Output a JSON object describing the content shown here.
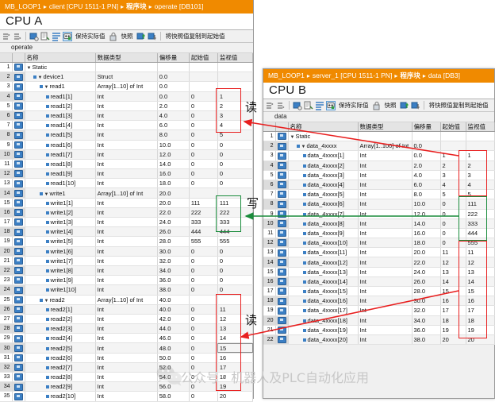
{
  "colors": {
    "breadcrumb_bg": "#f08a00",
    "monitor_cell_bg": "#fbc56b",
    "read_box": "#e81f1f",
    "write_box": "#1a8c3c"
  },
  "cpu_a": {
    "breadcrumb": {
      "project": "MB_LOOP1",
      "device": "client [CPU 1511-1 PN]",
      "folder": "程序块",
      "block": "operate [DB101]",
      "separator": "▸"
    },
    "title": "CPU A",
    "toolbar": {
      "keep_actual_label": "保持实际值",
      "snapshot_label": "快照",
      "copy_snapshot_label": "将快照值复制到起始值"
    },
    "block_name": "operate",
    "columns": [
      "名称",
      "数据类型",
      "偏移量",
      "起始值",
      "监视值"
    ],
    "rows": [
      {
        "n": "1",
        "name": "Static",
        "type": "",
        "offset": "",
        "start": "",
        "monitor": "",
        "indent": 0,
        "expander": "▼",
        "bullet": false
      },
      {
        "n": "2",
        "name": "device1",
        "type": "Struct",
        "offset": "0.0",
        "start": "",
        "monitor": "",
        "indent": 1,
        "expander": "▼",
        "bullet": true
      },
      {
        "n": "3",
        "name": "read1",
        "type": "Array[1..10] of Int",
        "offset": "0.0",
        "start": "",
        "monitor": "",
        "indent": 2,
        "expander": "▼",
        "bullet": true
      },
      {
        "n": "4",
        "name": "read1[1]",
        "type": "Int",
        "offset": "0.0",
        "start": "0",
        "monitor": "1",
        "indent": 3,
        "expander": "",
        "bullet": true
      },
      {
        "n": "5",
        "name": "read1[2]",
        "type": "Int",
        "offset": "2.0",
        "start": "0",
        "monitor": "2",
        "indent": 3,
        "expander": "",
        "bullet": true
      },
      {
        "n": "6",
        "name": "read1[3]",
        "type": "Int",
        "offset": "4.0",
        "start": "0",
        "monitor": "3",
        "indent": 3,
        "expander": "",
        "bullet": true
      },
      {
        "n": "7",
        "name": "read1[4]",
        "type": "Int",
        "offset": "6.0",
        "start": "0",
        "monitor": "4",
        "indent": 3,
        "expander": "",
        "bullet": true
      },
      {
        "n": "8",
        "name": "read1[5]",
        "type": "Int",
        "offset": "8.0",
        "start": "0",
        "monitor": "5",
        "indent": 3,
        "expander": "",
        "bullet": true
      },
      {
        "n": "9",
        "name": "read1[6]",
        "type": "Int",
        "offset": "10.0",
        "start": "0",
        "monitor": "0",
        "indent": 3,
        "expander": "",
        "bullet": true
      },
      {
        "n": "10",
        "name": "read1[7]",
        "type": "Int",
        "offset": "12.0",
        "start": "0",
        "monitor": "0",
        "indent": 3,
        "expander": "",
        "bullet": true
      },
      {
        "n": "11",
        "name": "read1[8]",
        "type": "Int",
        "offset": "14.0",
        "start": "0",
        "monitor": "0",
        "indent": 3,
        "expander": "",
        "bullet": true
      },
      {
        "n": "12",
        "name": "read1[9]",
        "type": "Int",
        "offset": "16.0",
        "start": "0",
        "monitor": "0",
        "indent": 3,
        "expander": "",
        "bullet": true
      },
      {
        "n": "13",
        "name": "read1[10]",
        "type": "Int",
        "offset": "18.0",
        "start": "0",
        "monitor": "0",
        "indent": 3,
        "expander": "",
        "bullet": true
      },
      {
        "n": "14",
        "name": "write1",
        "type": "Array[1..10] of Int",
        "offset": "20.0",
        "start": "",
        "monitor": "",
        "indent": 2,
        "expander": "▼",
        "bullet": true
      },
      {
        "n": "15",
        "name": "write1[1]",
        "type": "Int",
        "offset": "20.0",
        "start": "111",
        "monitor": "111",
        "indent": 3,
        "expander": "",
        "bullet": true
      },
      {
        "n": "16",
        "name": "write1[2]",
        "type": "Int",
        "offset": "22.0",
        "start": "222",
        "monitor": "222",
        "indent": 3,
        "expander": "",
        "bullet": true
      },
      {
        "n": "17",
        "name": "write1[3]",
        "type": "Int",
        "offset": "24.0",
        "start": "333",
        "monitor": "333",
        "indent": 3,
        "expander": "",
        "bullet": true
      },
      {
        "n": "18",
        "name": "write1[4]",
        "type": "Int",
        "offset": "26.0",
        "start": "444",
        "monitor": "444",
        "indent": 3,
        "expander": "",
        "bullet": true
      },
      {
        "n": "19",
        "name": "write1[5]",
        "type": "Int",
        "offset": "28.0",
        "start": "555",
        "monitor": "555",
        "indent": 3,
        "expander": "",
        "bullet": true
      },
      {
        "n": "20",
        "name": "write1[6]",
        "type": "Int",
        "offset": "30.0",
        "start": "0",
        "monitor": "0",
        "indent": 3,
        "expander": "",
        "bullet": true
      },
      {
        "n": "21",
        "name": "write1[7]",
        "type": "Int",
        "offset": "32.0",
        "start": "0",
        "monitor": "0",
        "indent": 3,
        "expander": "",
        "bullet": true
      },
      {
        "n": "22",
        "name": "write1[8]",
        "type": "Int",
        "offset": "34.0",
        "start": "0",
        "monitor": "0",
        "indent": 3,
        "expander": "",
        "bullet": true
      },
      {
        "n": "23",
        "name": "write1[9]",
        "type": "Int",
        "offset": "36.0",
        "start": "0",
        "monitor": "0",
        "indent": 3,
        "expander": "",
        "bullet": true
      },
      {
        "n": "24",
        "name": "write1[10]",
        "type": "Int",
        "offset": "38.0",
        "start": "0",
        "monitor": "0",
        "indent": 3,
        "expander": "",
        "bullet": true
      },
      {
        "n": "25",
        "name": "read2",
        "type": "Array[1..10] of Int",
        "offset": "40.0",
        "start": "",
        "monitor": "",
        "indent": 2,
        "expander": "▼",
        "bullet": true
      },
      {
        "n": "26",
        "name": "read2[1]",
        "type": "Int",
        "offset": "40.0",
        "start": "0",
        "monitor": "11",
        "indent": 3,
        "expander": "",
        "bullet": true
      },
      {
        "n": "27",
        "name": "read2[2]",
        "type": "Int",
        "offset": "42.0",
        "start": "0",
        "monitor": "12",
        "indent": 3,
        "expander": "",
        "bullet": true
      },
      {
        "n": "28",
        "name": "read2[3]",
        "type": "Int",
        "offset": "44.0",
        "start": "0",
        "monitor": "13",
        "indent": 3,
        "expander": "",
        "bullet": true
      },
      {
        "n": "29",
        "name": "read2[4]",
        "type": "Int",
        "offset": "46.0",
        "start": "0",
        "monitor": "14",
        "indent": 3,
        "expander": "",
        "bullet": true
      },
      {
        "n": "30",
        "name": "read2[5]",
        "type": "Int",
        "offset": "48.0",
        "start": "0",
        "monitor": "15",
        "indent": 3,
        "expander": "",
        "bullet": true,
        "selected": true
      },
      {
        "n": "31",
        "name": "read2[6]",
        "type": "Int",
        "offset": "50.0",
        "start": "0",
        "monitor": "16",
        "indent": 3,
        "expander": "",
        "bullet": true
      },
      {
        "n": "32",
        "name": "read2[7]",
        "type": "Int",
        "offset": "52.0",
        "start": "0",
        "monitor": "17",
        "indent": 3,
        "expander": "",
        "bullet": true
      },
      {
        "n": "33",
        "name": "read2[8]",
        "type": "Int",
        "offset": "54.0",
        "start": "0",
        "monitor": "18",
        "indent": 3,
        "expander": "",
        "bullet": true
      },
      {
        "n": "34",
        "name": "read2[9]",
        "type": "Int",
        "offset": "56.0",
        "start": "0",
        "monitor": "19",
        "indent": 3,
        "expander": "",
        "bullet": true
      },
      {
        "n": "35",
        "name": "read2[10]",
        "type": "Int",
        "offset": "58.0",
        "start": "0",
        "monitor": "20",
        "indent": 3,
        "expander": "",
        "bullet": true
      }
    ]
  },
  "cpu_b": {
    "breadcrumb": {
      "project": "MB_LOOP1",
      "device": "server_1 [CPU 1511-1 PN]",
      "folder": "程序块",
      "block": "data [DB3]",
      "separator": "▸"
    },
    "title": "CPU B",
    "toolbar": {
      "keep_actual_label": "保持实际值",
      "snapshot_label": "快照",
      "copy_snapshot_label": "将快照值复制到起始值"
    },
    "block_name": "data",
    "columns": [
      "名称",
      "数据类型",
      "偏移量",
      "起始值",
      "监视值"
    ],
    "rows": [
      {
        "n": "1",
        "name": "Static",
        "type": "",
        "offset": "",
        "start": "",
        "monitor": "",
        "indent": 0,
        "expander": "▼",
        "bullet": false
      },
      {
        "n": "2",
        "name": "data_4xxxx",
        "type": "Array[1..100] of Int",
        "offset": "0.0",
        "start": "",
        "monitor": "",
        "indent": 1,
        "expander": "▼",
        "bullet": true
      },
      {
        "n": "3",
        "name": "data_4xxxx[1]",
        "type": "Int",
        "offset": "0.0",
        "start": "1",
        "monitor": "1",
        "indent": 2,
        "expander": "",
        "bullet": true
      },
      {
        "n": "4",
        "name": "data_4xxxx[2]",
        "type": "Int",
        "offset": "2.0",
        "start": "2",
        "monitor": "2",
        "indent": 2,
        "expander": "",
        "bullet": true
      },
      {
        "n": "5",
        "name": "data_4xxxx[3]",
        "type": "Int",
        "offset": "4.0",
        "start": "3",
        "monitor": "3",
        "indent": 2,
        "expander": "",
        "bullet": true
      },
      {
        "n": "6",
        "name": "data_4xxxx[4]",
        "type": "Int",
        "offset": "6.0",
        "start": "4",
        "monitor": "4",
        "indent": 2,
        "expander": "",
        "bullet": true
      },
      {
        "n": "7",
        "name": "data_4xxxx[5]",
        "type": "Int",
        "offset": "8.0",
        "start": "5",
        "monitor": "5",
        "indent": 2,
        "expander": "",
        "bullet": true
      },
      {
        "n": "8",
        "name": "data_4xxxx[6]",
        "type": "Int",
        "offset": "10.0",
        "start": "0",
        "monitor": "111",
        "indent": 2,
        "expander": "",
        "bullet": true
      },
      {
        "n": "9",
        "name": "data_4xxxx[7]",
        "type": "Int",
        "offset": "12.0",
        "start": "0",
        "monitor": "222",
        "indent": 2,
        "expander": "",
        "bullet": true
      },
      {
        "n": "10",
        "name": "data_4xxxx[8]",
        "type": "Int",
        "offset": "14.0",
        "start": "0",
        "monitor": "333",
        "indent": 2,
        "expander": "",
        "bullet": true
      },
      {
        "n": "11",
        "name": "data_4xxxx[9]",
        "type": "Int",
        "offset": "16.0",
        "start": "0",
        "monitor": "444",
        "indent": 2,
        "expander": "",
        "bullet": true
      },
      {
        "n": "12",
        "name": "data_4xxxx[10]",
        "type": "Int",
        "offset": "18.0",
        "start": "0",
        "monitor": "555",
        "indent": 2,
        "expander": "",
        "bullet": true
      },
      {
        "n": "13",
        "name": "data_4xxxx[11]",
        "type": "Int",
        "offset": "20.0",
        "start": "11",
        "monitor": "11",
        "indent": 2,
        "expander": "",
        "bullet": true
      },
      {
        "n": "14",
        "name": "data_4xxxx[12]",
        "type": "Int",
        "offset": "22.0",
        "start": "12",
        "monitor": "12",
        "indent": 2,
        "expander": "",
        "bullet": true
      },
      {
        "n": "15",
        "name": "data_4xxxx[13]",
        "type": "Int",
        "offset": "24.0",
        "start": "13",
        "monitor": "13",
        "indent": 2,
        "expander": "",
        "bullet": true
      },
      {
        "n": "16",
        "name": "data_4xxxx[14]",
        "type": "Int",
        "offset": "26.0",
        "start": "14",
        "monitor": "14",
        "indent": 2,
        "expander": "",
        "bullet": true
      },
      {
        "n": "17",
        "name": "data_4xxxx[15]",
        "type": "Int",
        "offset": "28.0",
        "start": "15",
        "monitor": "15",
        "indent": 2,
        "expander": "",
        "bullet": true
      },
      {
        "n": "18",
        "name": "data_4xxxx[16]",
        "type": "Int",
        "offset": "30.0",
        "start": "16",
        "monitor": "16",
        "indent": 2,
        "expander": "",
        "bullet": true
      },
      {
        "n": "19",
        "name": "data_4xxxx[17]",
        "type": "Int",
        "offset": "32.0",
        "start": "17",
        "monitor": "17",
        "indent": 2,
        "expander": "",
        "bullet": true
      },
      {
        "n": "20",
        "name": "data_4xxxx[18]",
        "type": "Int",
        "offset": "34.0",
        "start": "18",
        "monitor": "18",
        "indent": 2,
        "expander": "",
        "bullet": true
      },
      {
        "n": "21",
        "name": "data_4xxxx[19]",
        "type": "Int",
        "offset": "36.0",
        "start": "19",
        "monitor": "19",
        "indent": 2,
        "expander": "",
        "bullet": true
      },
      {
        "n": "22",
        "name": "data_4xxxx[20]",
        "type": "Int",
        "offset": "38.0",
        "start": "20",
        "monitor": "20",
        "indent": 2,
        "expander": "",
        "bullet": true
      }
    ]
  },
  "annotations": {
    "read_top": "读",
    "write_mid": "写",
    "read_bottom": "读"
  },
  "watermark": {
    "text": "公众号 · 机器人及PLC自动化应用"
  }
}
